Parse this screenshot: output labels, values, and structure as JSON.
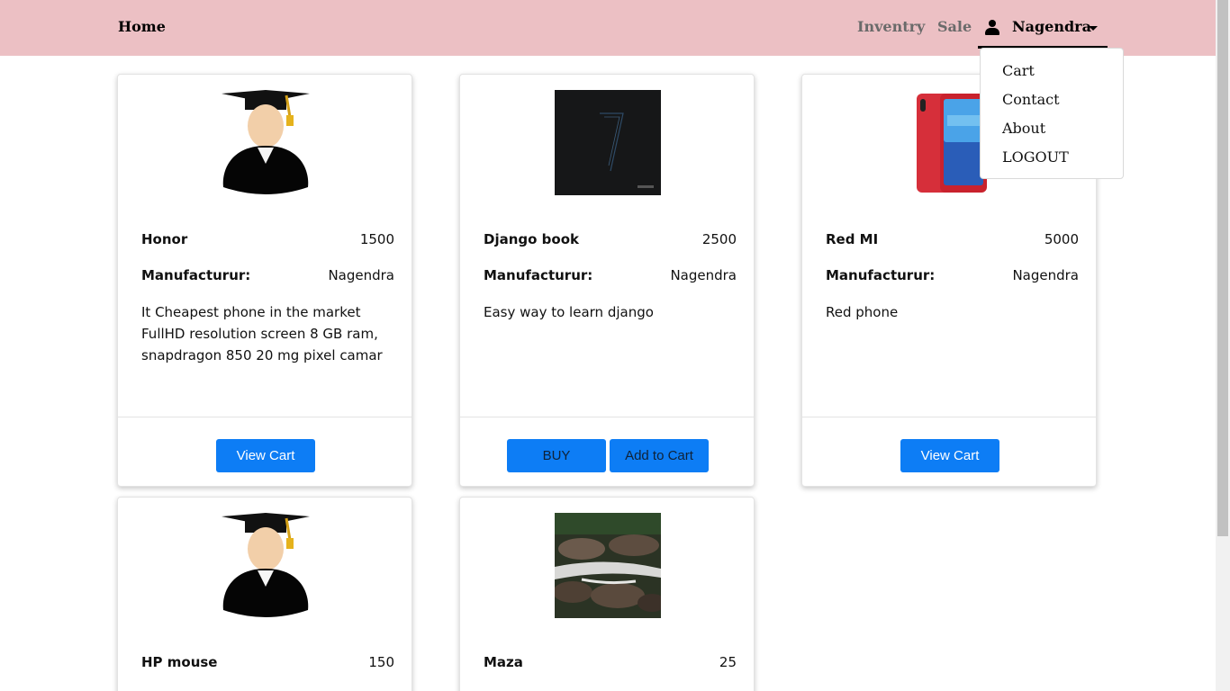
{
  "navbar": {
    "brand": "Home",
    "links": [
      "Inventry",
      "Sale"
    ],
    "user_name": "Nagendra"
  },
  "dropdown": {
    "items": [
      "Cart",
      "Contact",
      "About",
      "LOGOUT"
    ]
  },
  "labels": {
    "manufacturer": "Manufacturur:"
  },
  "products": [
    {
      "name": "Honor",
      "price": "1500",
      "manufacturer": "Nagendra",
      "description": "It Cheapest phone in the market FullHD resolution screen 8 GB ram, snapdragon 850 20 mg pixel camar",
      "image": "graduate-avatar",
      "buttons": [
        "View Cart"
      ]
    },
    {
      "name": "Django book",
      "price": "2500",
      "manufacturer": "Nagendra",
      "description": "Easy way to learn django",
      "image": "dark-book-cover",
      "buttons": [
        "BUY",
        "Add to Cart"
      ]
    },
    {
      "name": "Red MI",
      "price": "5000",
      "manufacturer": "Nagendra",
      "description": "Red phone",
      "image": "red-phone",
      "buttons": [
        "View Cart"
      ]
    },
    {
      "name": "HP mouse",
      "price": "150",
      "image": "graduate-avatar"
    },
    {
      "name": "Maza",
      "price": "25",
      "image": "river-photo"
    }
  ],
  "colors": {
    "navbar": "#ecc0c4",
    "button": "#0d7df5"
  }
}
